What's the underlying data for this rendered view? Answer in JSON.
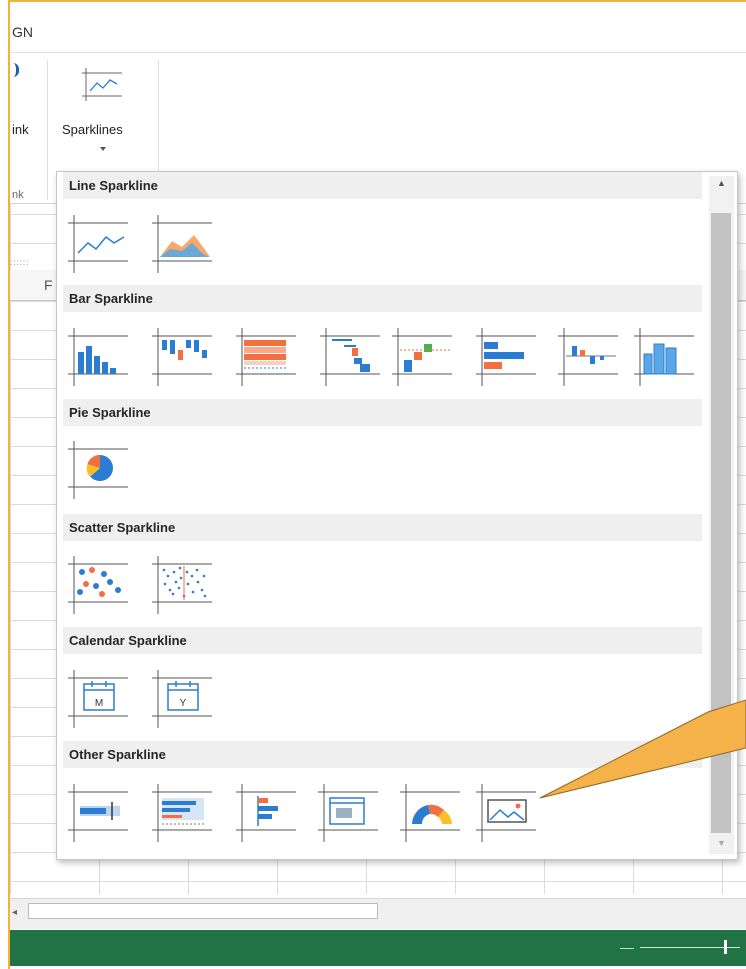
{
  "window": {
    "tab_fragment": "GN"
  },
  "ribbon": {
    "link_label": "ink",
    "link_group_label": "nk",
    "sparklines_label": "Sparklines"
  },
  "sheet": {
    "column_header": "F",
    "cell_dots": "::::::"
  },
  "gallery": {
    "sections": [
      {
        "title": "Line Sparkline",
        "items": [
          "line-sparkline-icon",
          "area-sparkline-icon"
        ]
      },
      {
        "title": "Bar Sparkline",
        "items": [
          "column-sparkline-icon",
          "winloss-sparkline-icon",
          "stacked-sparkline-icon",
          "cascade-sparkline-icon",
          "pareto-sparkline-icon",
          "hbar-sparkline-icon",
          "vari-sparkline-icon",
          "month-column-sparkline-icon"
        ]
      },
      {
        "title": "Pie Sparkline",
        "items": [
          "pie-sparkline-icon"
        ]
      },
      {
        "title": "Scatter Sparkline",
        "items": [
          "scatter-sparkline-icon",
          "spread-sparkline-icon"
        ]
      },
      {
        "title": "Calendar Sparkline",
        "items": [
          "month-sparkline-icon",
          "year-sparkline-icon"
        ]
      },
      {
        "title": "Other Sparkline",
        "items": [
          "bullet-sparkline-icon",
          "range-bullet-sparkline-icon",
          "box-plot-sparkline-icon",
          "image-box-sparkline-icon",
          "gauge-sparkline-icon",
          "image-sparkline-icon"
        ]
      }
    ],
    "calendar_letters": {
      "month": "M",
      "year": "Y"
    }
  },
  "colors": {
    "status_bar": "#217346",
    "callout": "#f5b14a",
    "icon_blue": "#2b7cd3",
    "icon_orange": "#f36f3f",
    "section_header_bg": "#efefef"
  }
}
